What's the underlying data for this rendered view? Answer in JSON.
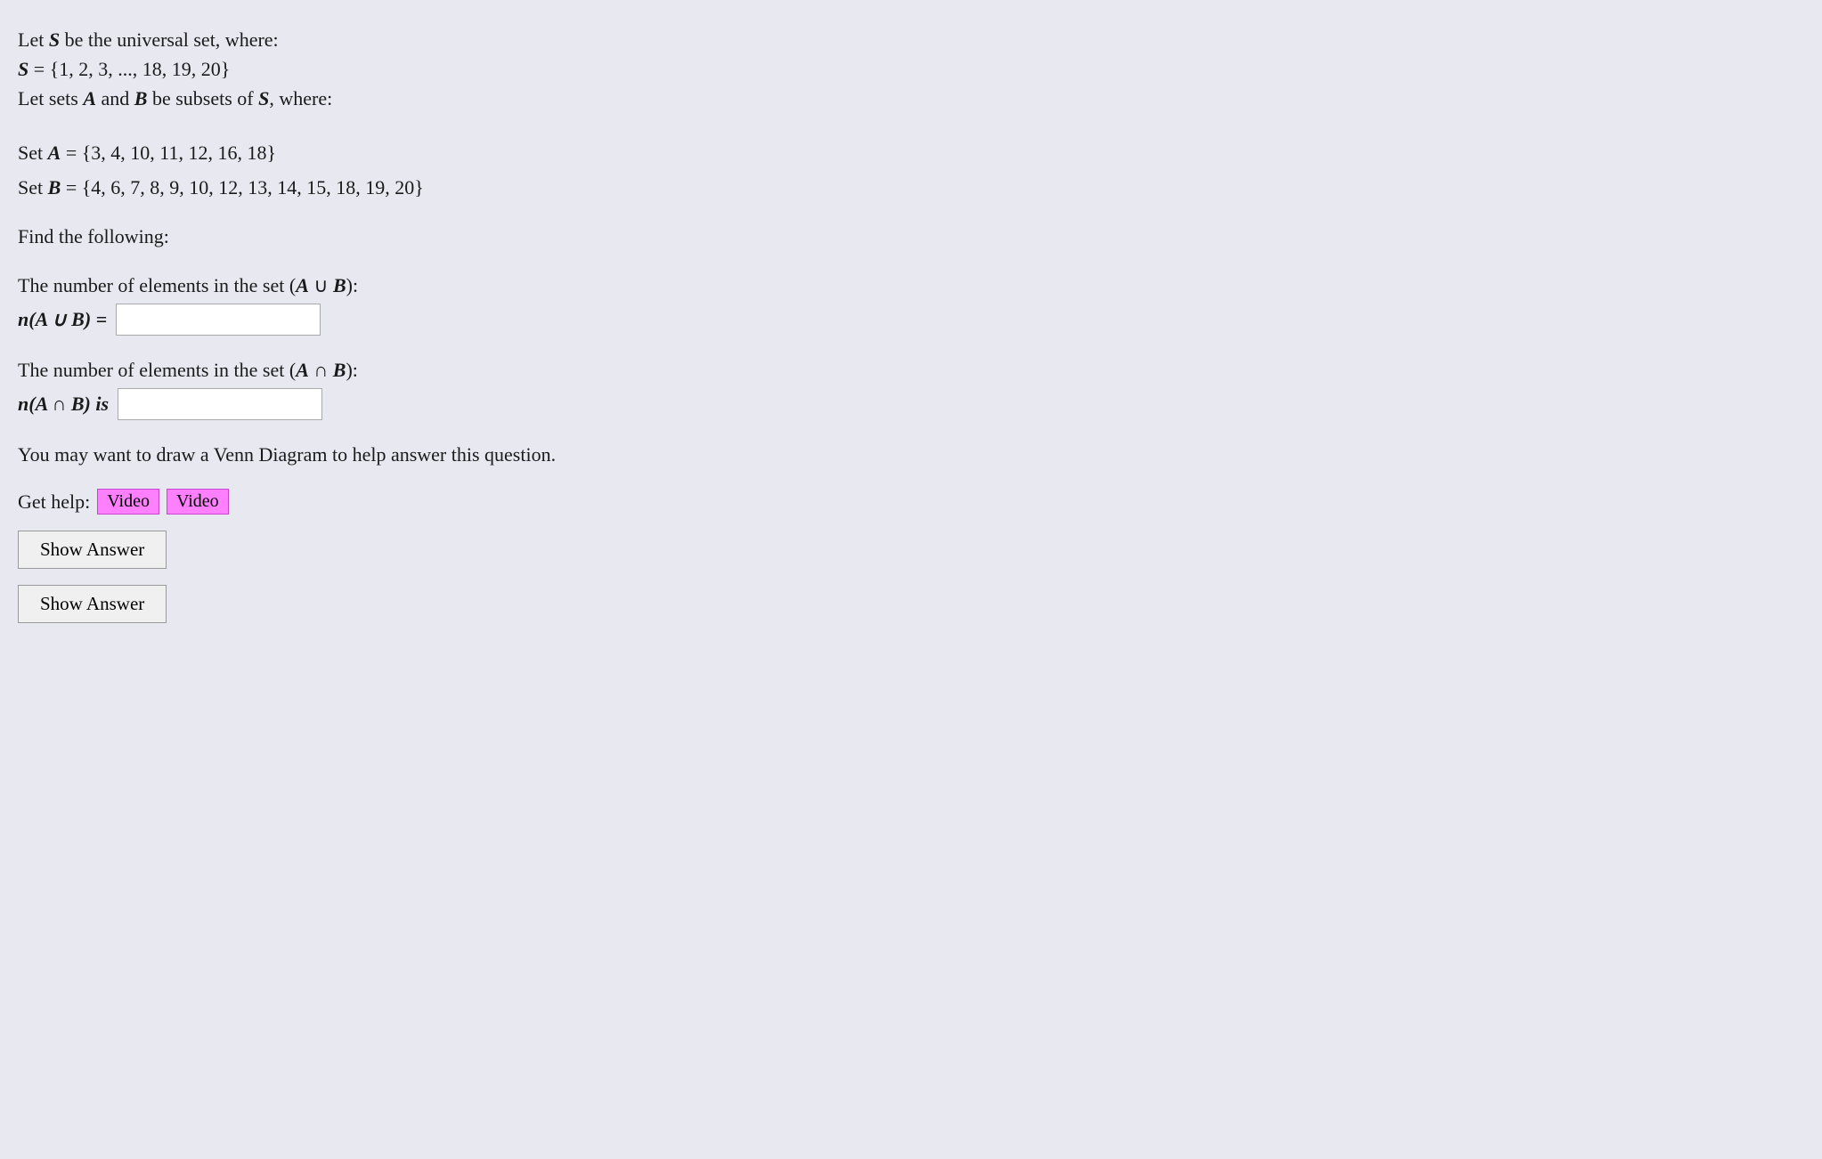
{
  "page": {
    "universal_set_line1": "Let S be the universal set, where:",
    "universal_set_line2": "S = {1, 2, 3, ..., 18, 19, 20}",
    "subsets_line": "Let sets A and B be subsets of S, where:",
    "set_a_label": "Set A = {3, 4, 10, 11, 12, 16, 18}",
    "set_b_label": "Set B = {4, 6, 7, 8, 9, 10, 12, 13, 14, 15, 18, 19, 20}",
    "find_label": "Find the following:",
    "union_desc": "The number of elements in the set (A ∪ B):",
    "union_label": "n(A ∪ B) =",
    "union_placeholder": "",
    "intersection_desc": "The number of elements in the set (A ∩ B):",
    "intersection_label": "n(A ∩ B) is",
    "intersection_placeholder": "",
    "hint_text": "You may want to draw a Venn Diagram to help answer this question.",
    "help_label": "Get help:",
    "video1_label": "Video",
    "video2_label": "Video",
    "show_answer_label": "Show Answer",
    "show_answer2_label": "Show Answer"
  }
}
